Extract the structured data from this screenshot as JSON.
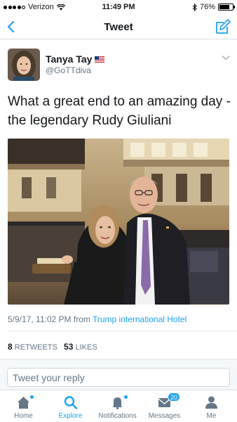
{
  "status_bar": {
    "carrier": "Verizon",
    "time": "11:49 PM",
    "battery_percent": "76%",
    "battery_level": 0.76,
    "icons": [
      "signal-dots",
      "wifi-icon",
      "bluetooth-icon",
      "battery-icon"
    ]
  },
  "nav": {
    "title": "Tweet",
    "back_icon": "chevron-left-icon",
    "compose_icon": "compose-icon"
  },
  "tweet": {
    "author_name": "Tanya Tay",
    "author_flag": "us-flag-icon",
    "author_handle": "@GoTTdiva",
    "text": "What a great end to an amazing day - the legendary Rudy Giuliani",
    "timestamp": "5/9/17, 11:02 PM",
    "from_word": "from",
    "location": "Trump international Hotel",
    "retweets_count": "8",
    "retweets_label": "RETWEETS",
    "likes_count": "53",
    "likes_label": "LIKES"
  },
  "reply": {
    "placeholder": "Tweet your reply"
  },
  "tabs": [
    {
      "label": "Home",
      "icon": "home-icon",
      "active": false,
      "dot": true
    },
    {
      "label": "Explore",
      "icon": "search-icon",
      "active": true,
      "dot": false
    },
    {
      "label": "Notifications",
      "icon": "bell-icon",
      "active": false,
      "dot": true
    },
    {
      "label": "Messages",
      "icon": "envelope-icon",
      "active": false,
      "badge": "20"
    },
    {
      "label": "Me",
      "icon": "person-icon",
      "active": false
    }
  ],
  "colors": {
    "accent": "#1da1f2",
    "text": "#14171a",
    "secondary": "#657786"
  }
}
